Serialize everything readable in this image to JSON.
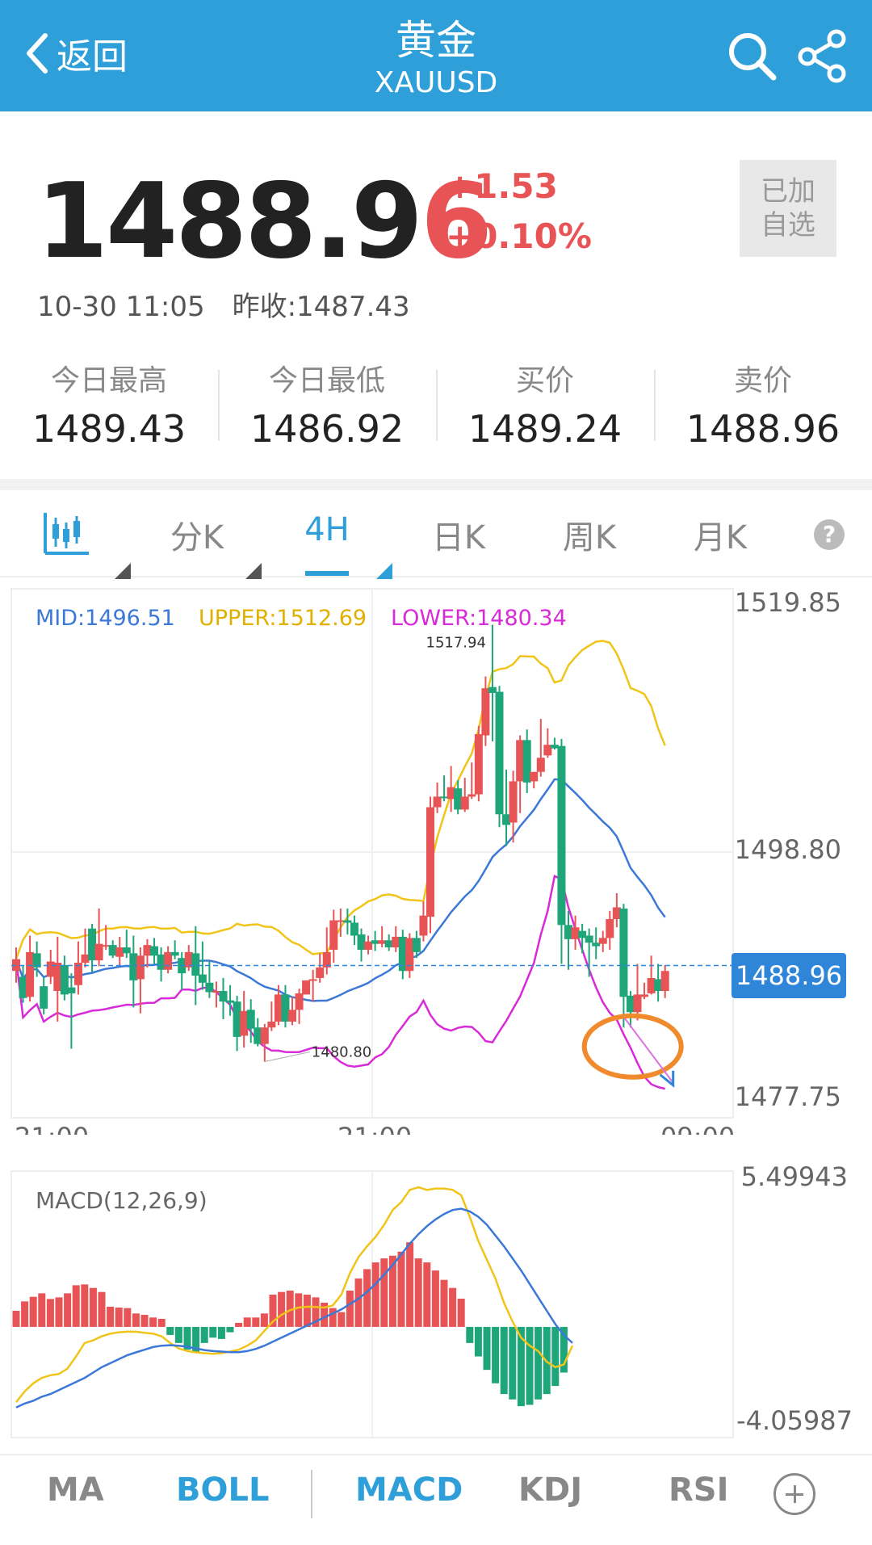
{
  "header": {
    "back_label": "返回",
    "title": "黄金",
    "symbol": "XAUUSD",
    "bg_color": "#2f9fd9",
    "icons": [
      "chevron-left-icon",
      "search-icon",
      "share-icon"
    ]
  },
  "quote": {
    "price_main": "1488.9",
    "price_last_digit": "6",
    "change": "+1.53",
    "change_pct": "+0.10%",
    "watch_line1": "已加",
    "watch_line2": "自选",
    "time": "10-30 11:05",
    "prev_close": "昨收:1487.43",
    "up_color": "#e85455",
    "down_color": "#1ea57a"
  },
  "stats": [
    {
      "label": "今日最高",
      "value": "1489.43"
    },
    {
      "label": "今日最低",
      "value": "1486.92"
    },
    {
      "label": "买价",
      "value": "1489.24"
    },
    {
      "label": "卖价",
      "value": "1488.96"
    }
  ],
  "tabs": {
    "icon": "candlestick-icon",
    "items": [
      "分K",
      "4H",
      "日K",
      "周K",
      "月K"
    ],
    "active": "4H",
    "help": "?"
  },
  "chart_data": {
    "type": "candlestick",
    "indicator": "BOLL",
    "legend": {
      "mid": "MID:1496.51",
      "upper": "UPPER:1512.69",
      "lower": "LOWER:1480.34"
    },
    "colors": {
      "mid": "#3b78d8",
      "upper": "#f0c419",
      "lower": "#d82ad8"
    },
    "y_ticks": [
      "1519.85",
      "1498.80",
      "1477.75"
    ],
    "ylim": [
      1477.75,
      1519.85
    ],
    "x_ticks": [
      "21:00",
      "21:00",
      "09:00"
    ],
    "current_price": "1488.96",
    "max_label": "1517.94",
    "min_label": "1480.80",
    "candles": [
      [
        1488.5,
        1489.5,
        1490.5,
        1487.5
      ],
      [
        1488.0,
        1486.2,
        1489.0,
        1485.8
      ],
      [
        1486.3,
        1490.1,
        1491.5,
        1485.9
      ],
      [
        1490.0,
        1488.8,
        1491.0,
        1488.0
      ],
      [
        1487.2,
        1485.3,
        1488.0,
        1484.8
      ],
      [
        1488.0,
        1489.3,
        1490.3,
        1487.4
      ],
      [
        1486.8,
        1489.2,
        1491.4,
        1484.2
      ],
      [
        1489.0,
        1486.5,
        1489.8,
        1486.0
      ],
      [
        1487.1,
        1486.6,
        1488.3,
        1481.9
      ],
      [
        1487.3,
        1489.2,
        1491.0,
        1486.5
      ],
      [
        1489.2,
        1489.9,
        1492.1,
        1488.8
      ],
      [
        1492.1,
        1489.4,
        1492.5,
        1488.4
      ],
      [
        1489.4,
        1490.8,
        1493.8,
        1488.9
      ],
      [
        1490.6,
        1490.7,
        1492.4,
        1490.3
      ],
      [
        1490.7,
        1489.8,
        1491.1,
        1489.6
      ],
      [
        1489.7,
        1490.5,
        1491.4,
        1489.0
      ],
      [
        1490.5,
        1490.0,
        1492.0,
        1489.6
      ],
      [
        1490.0,
        1487.7,
        1491.5,
        1485.4
      ],
      [
        1487.8,
        1489.8,
        1490.5,
        1484.9
      ],
      [
        1489.8,
        1490.7,
        1491.2,
        1488.8
      ],
      [
        1490.6,
        1489.8,
        1491.3,
        1489.1
      ],
      [
        1489.9,
        1488.6,
        1490.5,
        1487.6
      ],
      [
        1488.6,
        1490.1,
        1490.6,
        1488.3
      ],
      [
        1490.1,
        1489.8,
        1491.1,
        1489.5
      ],
      [
        1489.6,
        1488.3,
        1490.1,
        1486.9
      ],
      [
        1488.8,
        1490.1,
        1490.7,
        1488.5
      ],
      [
        1490.0,
        1488.1,
        1492.3,
        1485.6
      ],
      [
        1488.2,
        1487.5,
        1491.0,
        1486.9
      ],
      [
        1487.5,
        1486.7,
        1489.3,
        1486.2
      ],
      [
        1486.7,
        1486.8,
        1487.6,
        1485.4
      ],
      [
        1486.8,
        1485.9,
        1487.9,
        1484.4
      ],
      [
        1486.0,
        1485.8,
        1487.3,
        1484.7
      ],
      [
        1485.9,
        1482.9,
        1486.4,
        1481.7
      ],
      [
        1483.0,
        1485.1,
        1486.8,
        1482.0
      ],
      [
        1485.2,
        1483.6,
        1486.1,
        1482.4
      ],
      [
        1483.7,
        1482.3,
        1484.5,
        1482.1
      ],
      [
        1482.3,
        1483.7,
        1484.0,
        1480.8
      ],
      [
        1483.7,
        1484.2,
        1485.9,
        1483.4
      ],
      [
        1484.2,
        1486.5,
        1487.3,
        1483.9
      ],
      [
        1486.5,
        1484.2,
        1487.3,
        1483.7
      ],
      [
        1484.2,
        1485.2,
        1486.3,
        1483.9
      ],
      [
        1485.2,
        1486.6,
        1487.0,
        1484.0
      ],
      [
        1486.5,
        1487.7,
        1487.6,
        1487.3
      ],
      [
        1487.7,
        1487.8,
        1488.6,
        1485.9
      ],
      [
        1487.9,
        1488.8,
        1490.0,
        1487.5
      ],
      [
        1488.8,
        1490.1,
        1492.2,
        1488.2
      ],
      [
        1490.3,
        1492.8,
        1493.7,
        1489.2
      ],
      [
        1492.8,
        1492.8,
        1493.8,
        1491.4
      ],
      [
        1492.8,
        1492.6,
        1493.8,
        1491.6
      ],
      [
        1492.6,
        1491.5,
        1493.2,
        1490.7
      ],
      [
        1491.6,
        1490.3,
        1492.1,
        1489.3
      ],
      [
        1490.3,
        1491.0,
        1491.5,
        1489.9
      ],
      [
        1491.1,
        1490.8,
        1491.9,
        1490.2
      ],
      [
        1490.8,
        1491.1,
        1492.3,
        1490.5
      ],
      [
        1491.1,
        1490.5,
        1491.6,
        1490.2
      ],
      [
        1490.5,
        1491.4,
        1492.3,
        1490.1
      ],
      [
        1491.4,
        1488.5,
        1492.0,
        1487.8
      ],
      [
        1488.5,
        1491.3,
        1491.7,
        1487.9
      ],
      [
        1491.3,
        1490.1,
        1491.9,
        1489.6
      ],
      [
        1491.5,
        1493.2,
        1494.4,
        1491.0
      ],
      [
        1493.1,
        1502.4,
        1503.3,
        1491.7
      ],
      [
        1502.4,
        1503.3,
        1504.5,
        1501.9
      ],
      [
        1503.3,
        1503.2,
        1505.1,
        1502.9
      ],
      [
        1503.1,
        1504.1,
        1505.9,
        1502.0
      ],
      [
        1504.0,
        1502.2,
        1504.7,
        1501.8
      ],
      [
        1502.2,
        1503.3,
        1504.9,
        1502.0
      ],
      [
        1503.3,
        1503.5,
        1506.2,
        1503.1
      ],
      [
        1503.5,
        1508.6,
        1509.3,
        1502.9
      ],
      [
        1508.5,
        1512.5,
        1513.5,
        1507.6
      ],
      [
        1512.6,
        1512.1,
        1517.9,
        1508.0
      ],
      [
        1512.2,
        1501.8,
        1512.7,
        1500.7
      ],
      [
        1501.8,
        1500.9,
        1505.6,
        1499.1
      ],
      [
        1501.1,
        1504.6,
        1505.5,
        1499.4
      ],
      [
        1504.6,
        1508.1,
        1508.5,
        1501.9
      ],
      [
        1508.1,
        1504.5,
        1509.0,
        1503.6
      ],
      [
        1504.6,
        1505.4,
        1505.4,
        1504.0
      ],
      [
        1505.4,
        1506.6,
        1509.9,
        1505.0
      ],
      [
        1506.8,
        1507.7,
        1509.1,
        1506.6
      ],
      [
        1507.7,
        1507.4,
        1508.3,
        1507.3
      ],
      [
        1507.6,
        1492.4,
        1508.2,
        1489.1
      ],
      [
        1492.4,
        1491.2,
        1493.6,
        1488.6
      ],
      [
        1491.2,
        1492.2,
        1493.2,
        1490.3
      ],
      [
        1491.9,
        1491.3,
        1492.5,
        1490.0
      ],
      [
        1491.5,
        1490.9,
        1492.1,
        1488.0
      ],
      [
        1490.9,
        1490.6,
        1492.2,
        1489.5
      ],
      [
        1490.8,
        1491.3,
        1491.9,
        1490.1
      ],
      [
        1491.3,
        1492.9,
        1493.6,
        1490.3
      ],
      [
        1492.9,
        1493.9,
        1495.1,
        1492.2
      ],
      [
        1493.8,
        1486.3,
        1494.2,
        1483.7
      ],
      [
        1486.4,
        1485.0,
        1486.8,
        1483.7
      ],
      [
        1485.0,
        1486.5,
        1489.1,
        1484.3
      ],
      [
        1486.3,
        1486.5,
        1487.5,
        1486.1
      ],
      [
        1486.6,
        1487.9,
        1489.8,
        1486.5
      ],
      [
        1487.8,
        1486.8,
        1489.1,
        1485.9
      ],
      [
        1486.8,
        1488.5,
        1489.0,
        1486.2
      ]
    ],
    "macd": {
      "title": "MACD(12,26,9)",
      "y_ticks": [
        "5.49943",
        "-4.05987"
      ],
      "ylim": [
        -4.05987,
        5.49943
      ],
      "hist": [
        0.6,
        0.95,
        1.12,
        1.25,
        1.04,
        1.1,
        1.25,
        1.55,
        1.58,
        1.45,
        1.3,
        0.75,
        0.72,
        0.7,
        0.5,
        0.45,
        0.35,
        0.3,
        -0.3,
        -0.6,
        -0.85,
        -0.95,
        -0.6,
        -0.4,
        -0.45,
        -0.2,
        0.15,
        0.35,
        0.35,
        0.5,
        1.2,
        1.3,
        1.35,
        1.25,
        1.2,
        1.1,
        0.9,
        0.7,
        0.55,
        1.35,
        1.8,
        2.15,
        2.4,
        2.55,
        2.65,
        2.8,
        3.15,
        2.55,
        2.4,
        2.1,
        1.75,
        1.45,
        1.05,
        -0.6,
        -1.1,
        -1.6,
        -2.1,
        -2.5,
        -2.7,
        -2.95,
        -2.9,
        -2.7,
        -2.5,
        -2.2,
        -1.7
      ],
      "dif": [
        -2.8,
        -2.4,
        -2.1,
        -1.9,
        -1.8,
        -1.75,
        -1.55,
        -1.1,
        -0.6,
        -0.5,
        -0.35,
        -0.25,
        -0.2,
        -0.18,
        -0.18,
        -0.22,
        -0.25,
        -0.35,
        -0.6,
        -0.8,
        -0.9,
        -0.95,
        -0.98,
        -1.0,
        -0.98,
        -0.92,
        -0.85,
        -0.7,
        -0.5,
        -0.15,
        0.2,
        0.45,
        0.62,
        0.72,
        0.75,
        0.74,
        0.72,
        0.8,
        1.2,
        2.0,
        2.6,
        3.0,
        3.35,
        3.8,
        4.35,
        4.65,
        5.1,
        5.2,
        5.1,
        5.15,
        5.15,
        5.1,
        4.9,
        4.1,
        3.2,
        2.5,
        1.8,
        0.9,
        0.2,
        -0.4,
        -0.7,
        -0.9,
        -1.3,
        -1.5,
        -1.4,
        -0.7
      ],
      "dea": [
        -3.0,
        -2.85,
        -2.75,
        -2.6,
        -2.5,
        -2.35,
        -2.2,
        -2.05,
        -1.9,
        -1.7,
        -1.5,
        -1.35,
        -1.2,
        -1.05,
        -0.95,
        -0.85,
        -0.75,
        -0.7,
        -0.68,
        -0.7,
        -0.74,
        -0.8,
        -0.86,
        -0.9,
        -0.92,
        -0.94,
        -0.94,
        -0.9,
        -0.82,
        -0.7,
        -0.55,
        -0.4,
        -0.25,
        -0.1,
        0.05,
        0.2,
        0.35,
        0.5,
        0.65,
        0.85,
        1.05,
        1.3,
        1.6,
        1.95,
        2.3,
        2.7,
        3.1,
        3.45,
        3.75,
        4.0,
        4.2,
        4.35,
        4.4,
        4.3,
        4.1,
        3.8,
        3.4,
        3.0,
        2.55,
        2.1,
        1.6,
        1.1,
        0.6,
        0.1,
        -0.3,
        -0.6
      ]
    }
  },
  "bottom_tabs": {
    "items": [
      "MA",
      "BOLL",
      "MACD",
      "KDJ",
      "RSI"
    ],
    "active": [
      "BOLL",
      "MACD"
    ],
    "add_icon": "add-circle-icon"
  }
}
